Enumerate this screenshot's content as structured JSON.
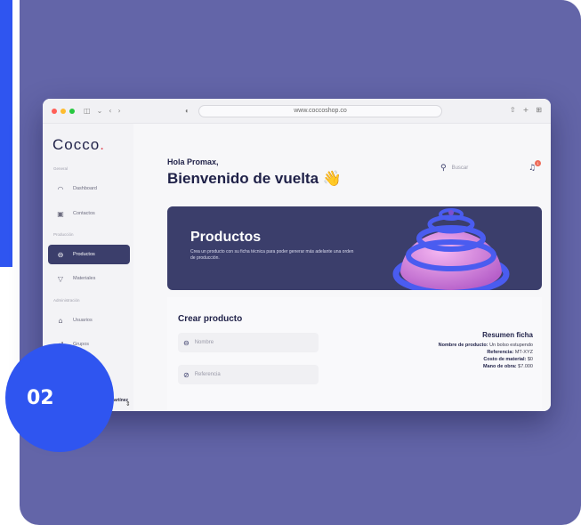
{
  "slide_number": "02",
  "browser": {
    "url": "www.coccoshop.co",
    "left_icons": [
      "sidebar-icon",
      "chevron-down-icon",
      "back-icon",
      "forward-icon"
    ],
    "right_icons": [
      "share-icon",
      "plus-icon",
      "grid-icon"
    ]
  },
  "sidebar": {
    "logo": "Cocco",
    "logo_dot": ".",
    "sections": {
      "general": "General",
      "produccion": "Producción",
      "administracion": "Administración"
    },
    "items": [
      {
        "label": "Dashboard",
        "icon": "dashboard-icon",
        "active": false
      },
      {
        "label": "Contactos",
        "icon": "contacts-icon",
        "active": false
      },
      {
        "label": "Productos",
        "icon": "bag-icon",
        "active": true
      },
      {
        "label": "Materiales",
        "icon": "filter-icon",
        "active": false
      },
      {
        "label": "Usuarios",
        "icon": "home-icon",
        "active": false
      },
      {
        "label": "Grupos",
        "icon": "group-icon",
        "active": false
      }
    ],
    "user": {
      "name": "ostaño Martínez",
      "role": "istrador"
    }
  },
  "header": {
    "greeting": "Hola Promax,",
    "welcome": "Bienvenido de vuelta 👋",
    "search_placeholder": "Buscar",
    "notification_count": "1"
  },
  "banner": {
    "title": "Productos",
    "description": "Crea un producto con su ficha técnica para poder generar más adelante una orden de producción.",
    "colors": {
      "bg": "#3b3e6b",
      "sphere": "#e58be6",
      "rings": "#4a5cf0"
    }
  },
  "form": {
    "title": "Crear producto",
    "fields": [
      {
        "placeholder": "Nombre",
        "icon": "bag-icon"
      },
      {
        "placeholder": "Referencia",
        "icon": "tag-icon"
      }
    ],
    "summary": {
      "title": "Resumen ficha",
      "rows": [
        {
          "label": "Nombre de producto:",
          "value": "Un bolso estupendo"
        },
        {
          "label": "Referencia:",
          "value": "MT-XYZ"
        },
        {
          "label": "Costo de material:",
          "value": "$0"
        },
        {
          "label": "Mano de obra:",
          "value": "$7.000"
        }
      ]
    }
  },
  "colors": {
    "card": "#6365a8",
    "accent_blue": "#2f55f0",
    "active": "#3b3e6b"
  }
}
